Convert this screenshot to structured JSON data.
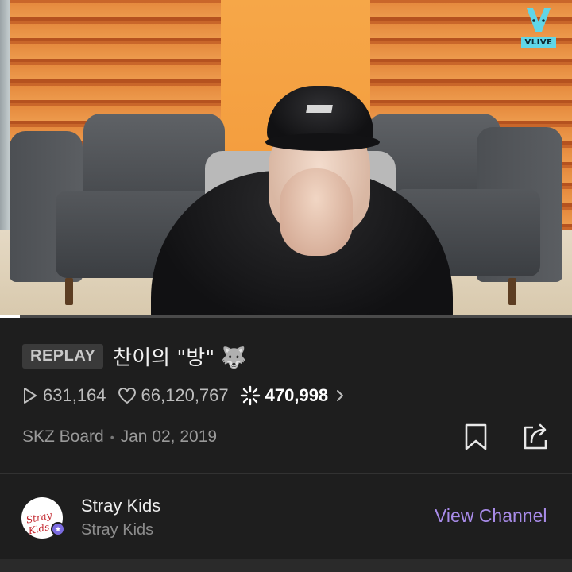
{
  "video": {
    "brand_tag": "VLIVE",
    "progress_fraction": 0.035
  },
  "title": {
    "badge": "REPLAY",
    "text": "찬이의 \"방\" 🐺"
  },
  "stats": {
    "plays": "631,164",
    "likes": "66,120,767",
    "comments": "470,998"
  },
  "meta": {
    "board": "SKZ Board",
    "separator": "•",
    "date": "Jan 02, 2019"
  },
  "channel": {
    "name": "Stray Kids",
    "subtitle": "Stray Kids",
    "avatar_text": "Stray Kids",
    "badge_symbol": "★",
    "view_label": "View Channel"
  },
  "colors": {
    "accent": "#a88be8",
    "background": "#1e1e1e",
    "vlive": "#5fd6e8"
  },
  "icons": [
    "play-icon",
    "heart-icon",
    "comment-sparkle-icon",
    "chevron-right-icon",
    "bookmark-icon",
    "share-icon",
    "vlive-logo-icon"
  ]
}
